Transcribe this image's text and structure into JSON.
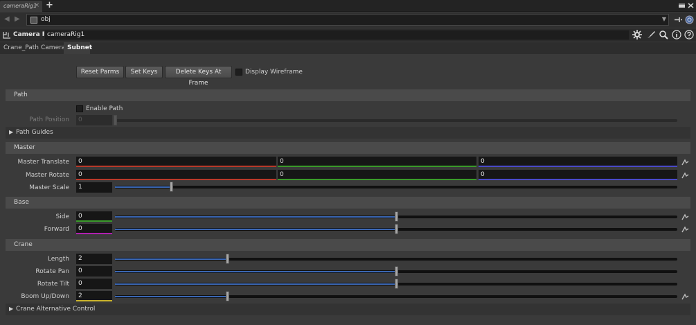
{
  "window": {
    "doc_tab": "cameraRig1",
    "doc_tab_close": "×",
    "new_tab": "+",
    "path": "obj"
  },
  "header": {
    "node_type": "Camera Rig",
    "node_name": "cameraRig1"
  },
  "tabs": [
    {
      "label": "Crane_Path"
    },
    {
      "label": "Camera"
    },
    {
      "label": "Subnet"
    }
  ],
  "toolbar": {
    "reset_parms": "Reset Parms",
    "set_keys": "Set Keys",
    "delete_keys": "Delete Keys At Frame",
    "display_wireframe": "Display Wireframe"
  },
  "path": {
    "section": "Path",
    "enable_path": "Enable Path",
    "path_position_label": "Path Position",
    "path_position_value": "0",
    "path_guides": "Path Guides"
  },
  "master": {
    "section": "Master",
    "translate_label": "Master Translate",
    "translate": [
      "0",
      "0",
      "0"
    ],
    "rotate_label": "Master Rotate",
    "rotate": [
      "0",
      "0",
      "0"
    ],
    "scale_label": "Master Scale",
    "scale_value": "1",
    "scale_slider_fraction": 0.1
  },
  "base": {
    "section": "Base",
    "side_label": "Side",
    "side_value": "0",
    "side_slider_fraction": 0.5,
    "forward_label": "Forward",
    "forward_value": "0",
    "forward_slider_fraction": 0.5
  },
  "crane": {
    "section": "Crane",
    "length_label": "Length",
    "length_value": "2",
    "length_slider_fraction": 0.2,
    "rotate_pan_label": "Rotate Pan",
    "rotate_pan_value": "0",
    "rotate_pan_slider_fraction": 0.5,
    "rotate_tilt_label": "Rotate Tilt",
    "rotate_tilt_value": "0",
    "rotate_tilt_slider_fraction": 0.5,
    "boom_label": "Boom Up/Down",
    "boom_value": "2",
    "boom_slider_fraction": 0.2,
    "alt_control": "Crane Alternative Control"
  },
  "colors": {
    "x_axis": "#b8392a",
    "y_axis": "#3a9a2a",
    "z_axis": "#4a4ac8",
    "slider_fill": "#3b67b3"
  },
  "icons": [
    "back-arrow-icon",
    "forward-arrow-icon",
    "pin-icon",
    "gear-icon",
    "brush-icon",
    "magnify-icon",
    "info-icon",
    "help-icon",
    "key-icon"
  ]
}
